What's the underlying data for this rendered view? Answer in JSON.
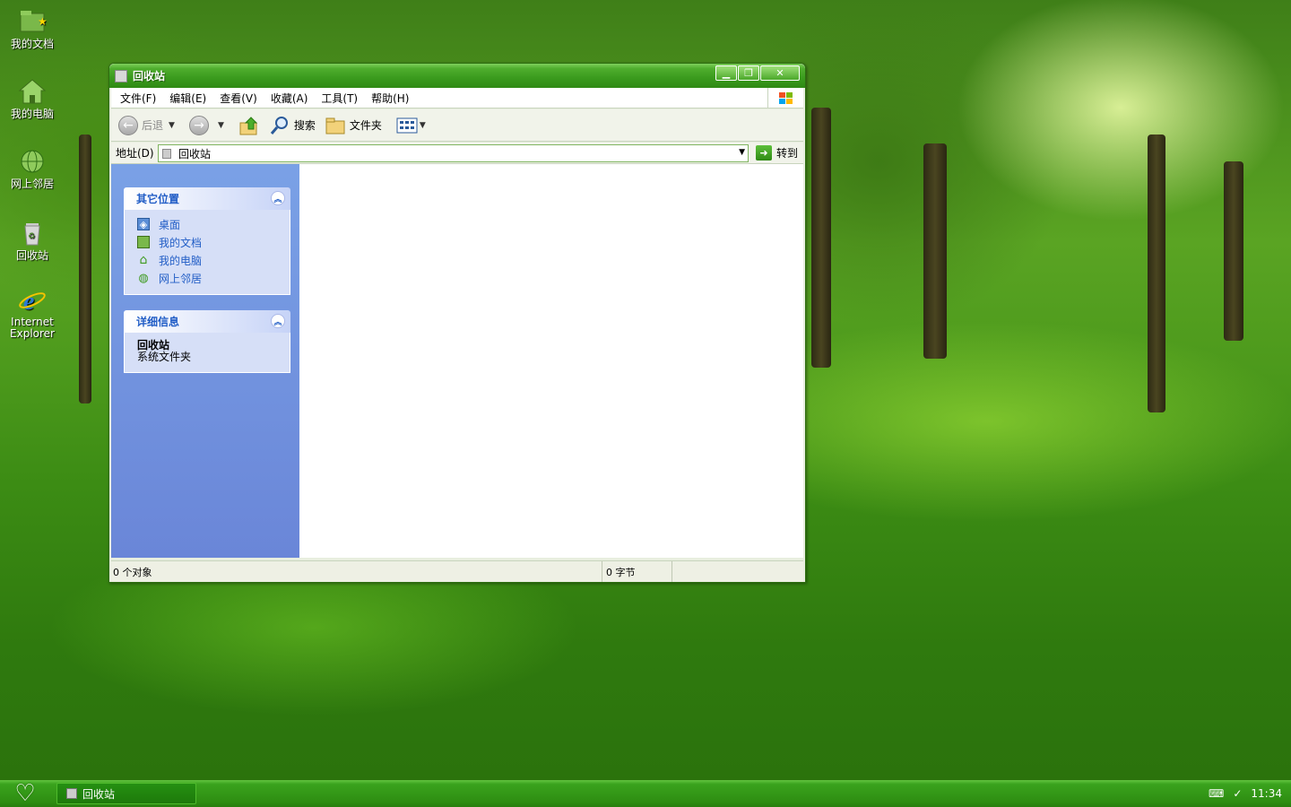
{
  "desktop": {
    "icons": [
      {
        "label": "我的文档",
        "icon": "my-documents-icon"
      },
      {
        "label": "我的电脑",
        "icon": "my-computer-icon"
      },
      {
        "label": "网上邻居",
        "icon": "network-places-icon"
      },
      {
        "label": "回收站",
        "icon": "recycle-bin-icon"
      },
      {
        "label_line1": "Internet",
        "label_line2": "Explorer",
        "icon": "internet-explorer-icon"
      }
    ]
  },
  "window": {
    "title": "回收站",
    "menu": [
      "文件(F)",
      "编辑(E)",
      "查看(V)",
      "收藏(A)",
      "工具(T)",
      "帮助(H)"
    ],
    "toolbar": {
      "back": "后退",
      "search": "搜索",
      "folders": "文件夹"
    },
    "address": {
      "label": "地址(D)",
      "value": "回收站",
      "go": "转到"
    },
    "left_pane": {
      "other_places": {
        "title": "其它位置",
        "links": [
          "桌面",
          "我的文档",
          "我的电脑",
          "网上邻居"
        ]
      },
      "details": {
        "title": "详细信息",
        "name": "回收站",
        "type": "系统文件夹"
      }
    },
    "status": {
      "objects": "0 个对象",
      "size": "0 字节"
    }
  },
  "taskbar": {
    "task": "回收站",
    "clock": "11:34"
  },
  "colors": {
    "title_green": "#3a9a1d",
    "link_blue": "#215dc6",
    "pane_blue": "#7aa1e6"
  }
}
